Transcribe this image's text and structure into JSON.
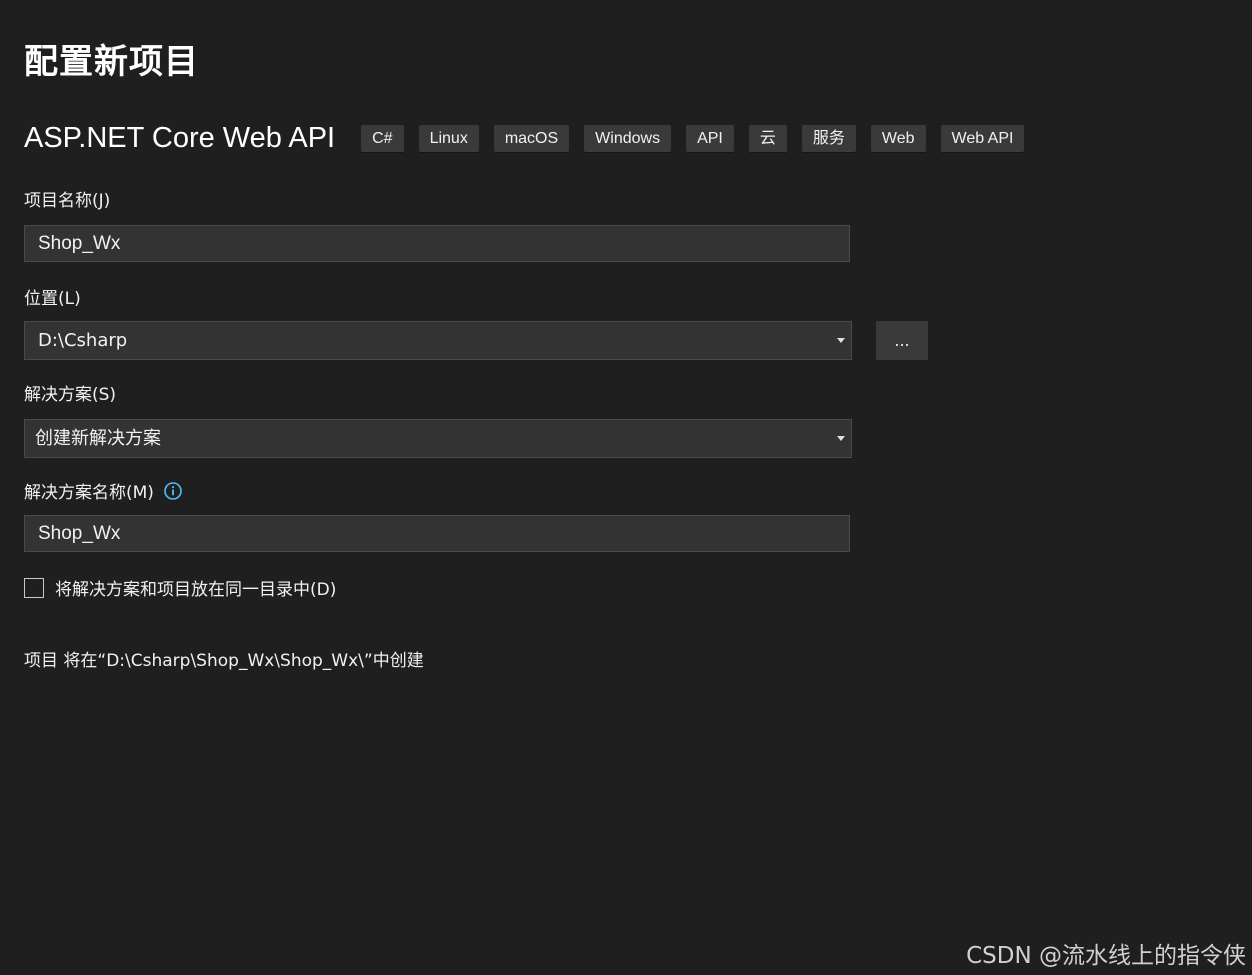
{
  "page": {
    "title": "配置新项目"
  },
  "template": {
    "name": "ASP.NET Core Web API",
    "tags": [
      "C#",
      "Linux",
      "macOS",
      "Windows",
      "API",
      "云",
      "服务",
      "Web",
      "Web API"
    ]
  },
  "project_name": {
    "label": "项目名称(J)",
    "value": "Shop_Wx"
  },
  "location": {
    "label": "位置(L)",
    "value": "D:\\Csharp",
    "browse_label": "..."
  },
  "solution": {
    "label": "解决方案(S)",
    "value": "创建新解决方案"
  },
  "solution_name": {
    "label": "解决方案名称(M)",
    "value": "Shop_Wx",
    "info_icon": "info-icon"
  },
  "same_directory": {
    "label": "将解决方案和项目放在同一目录中(D)",
    "checked": false
  },
  "path_note": "项目 将在“D:\\Csharp\\Shop_Wx\\Shop_Wx\\”中创建",
  "watermark": "CSDN @流水线上的指令侠",
  "colors": {
    "background": "#1f1f1f",
    "input_background": "#333333",
    "tag_background": "#3a3a3a",
    "info_accent": "#4fc1ff"
  }
}
